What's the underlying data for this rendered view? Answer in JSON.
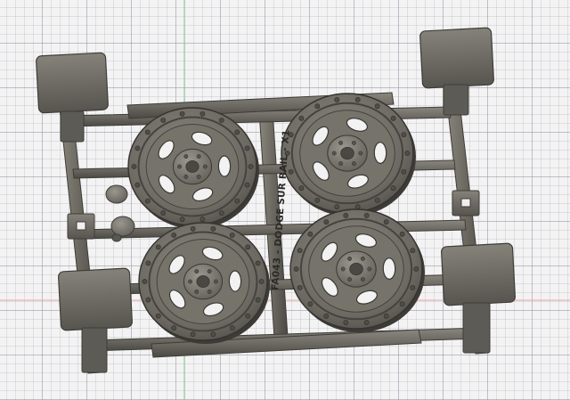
{
  "viewport": {
    "background": "#f3f3f4",
    "grid_color": "#9696a5",
    "axis_green": "#7fc98a",
    "axis_red": "#e9a2a2"
  },
  "model": {
    "part_label": "FA043 - DODGE SUR RAIL - X1",
    "material_color": "#6e6b63",
    "material_shadow": "#3f3d38",
    "wheel_count": 4
  }
}
